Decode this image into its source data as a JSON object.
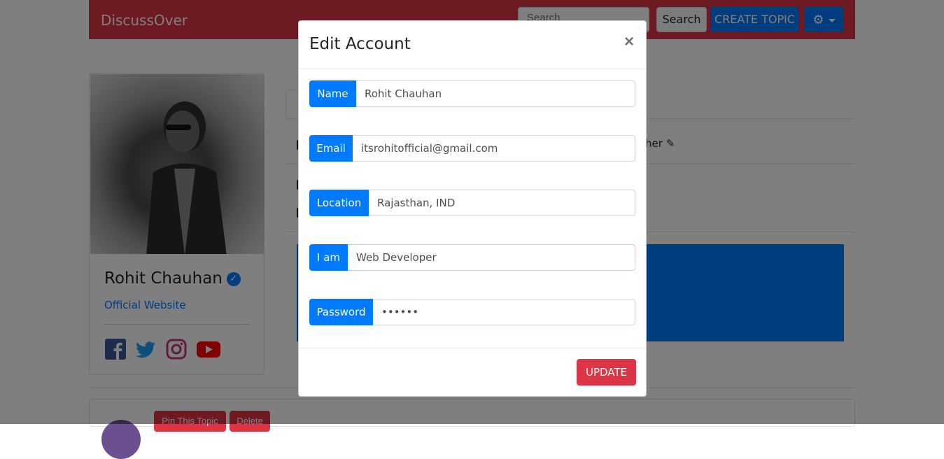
{
  "navbar": {
    "brand": "DiscussOver",
    "search_placeholder": "Search",
    "search_button": "Search",
    "create_topic": "CREATE TOPIC"
  },
  "profile": {
    "name": "Rohit Chauhan",
    "website_link": "Official Website"
  },
  "background_content": {
    "other_text": "her",
    "pin_button": "Pin This Topic",
    "delete_button": "Delete"
  },
  "modal": {
    "title": "Edit Account",
    "close_label": "×",
    "fields": [
      {
        "label": "Name",
        "value": "Rohit Chauhan"
      },
      {
        "label": "Email",
        "value": "itsrohitofficial@gmail.com"
      },
      {
        "label": "Location",
        "value": "Rajasthan, IND"
      },
      {
        "label": "I am",
        "value": "Web Developer"
      },
      {
        "label": "Password",
        "value": "••••••"
      }
    ],
    "update_button": "UPDATE"
  },
  "colors": {
    "navbar": "#dc3545",
    "primary": "#007bff",
    "danger": "#dc3545"
  }
}
